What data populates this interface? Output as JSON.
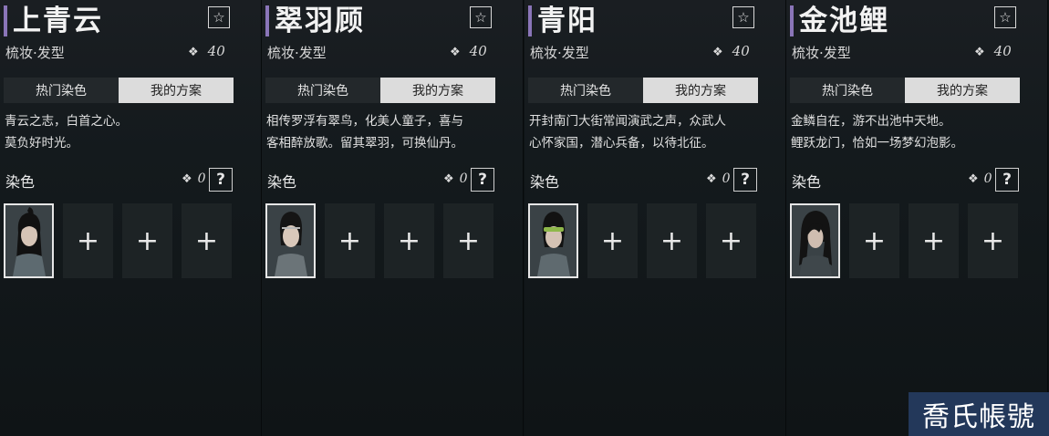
{
  "cards": [
    {
      "title": "上青云",
      "subtitle": "梳妆·发型",
      "cost": "40",
      "tabs": [
        "热门染色",
        "我的方案"
      ],
      "description": [
        "青云之志，白首之心。",
        "莫负好时光。"
      ],
      "dye_label": "染色",
      "dye_cost": "0",
      "help": "?",
      "slot_add": "+"
    },
    {
      "title": "翠羽顾",
      "subtitle": "梳妆·发型",
      "cost": "40",
      "tabs": [
        "热门染色",
        "我的方案"
      ],
      "description": [
        "相传罗浮有翠鸟，化美人童子，喜与",
        "客相醉放歌。留其翠羽，可换仙丹。"
      ],
      "dye_label": "染色",
      "dye_cost": "0",
      "help": "?",
      "slot_add": "+"
    },
    {
      "title": "青阳",
      "subtitle": "梳妆·发型",
      "cost": "40",
      "tabs": [
        "热门染色",
        "我的方案"
      ],
      "description": [
        "开封南门大街常闻演武之声，众武人",
        "心怀家国，潜心兵备，以待北征。"
      ],
      "dye_label": "染色",
      "dye_cost": "0",
      "help": "?",
      "slot_add": "+"
    },
    {
      "title": "金池鲤",
      "subtitle": "梳妆·发型",
      "cost": "40",
      "tabs": [
        "热门染色",
        "我的方案"
      ],
      "description": [
        "金鳞自在，游不出池中天地。",
        "鲤跃龙门，恰如一场梦幻泡影。"
      ],
      "dye_label": "染色",
      "dye_cost": "0",
      "help": "?",
      "slot_add": "+"
    }
  ],
  "icons": {
    "favorite": "star-outline-icon",
    "currency": "jade-coin-icon",
    "help": "question-mark-icon",
    "add": "plus-icon"
  },
  "colors": {
    "accent_bar": "#8a75b8",
    "active_tab": "#dcdcdc",
    "inactive_tab": "#23282b",
    "watermark_bg": "#23385a"
  },
  "watermark": "喬氏帳號"
}
